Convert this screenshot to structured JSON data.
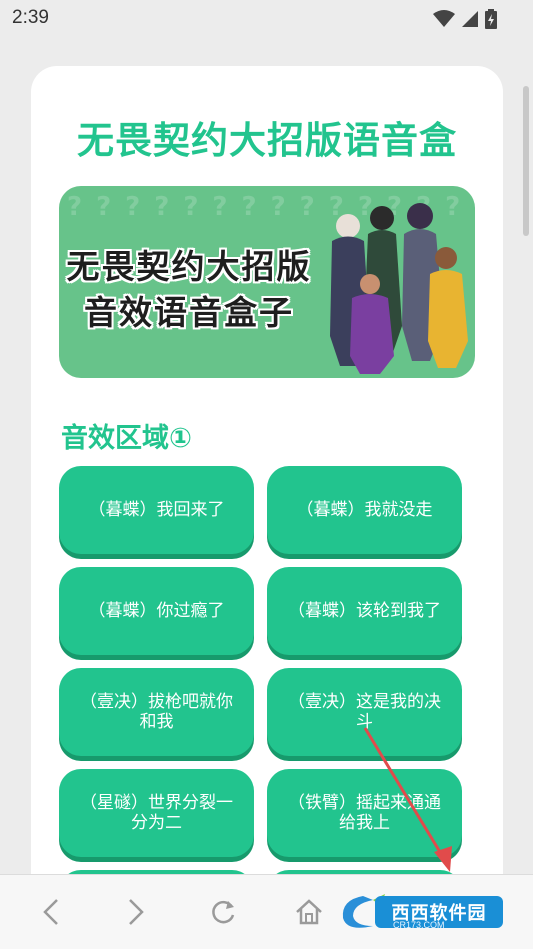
{
  "status_bar": {
    "time": "2:39"
  },
  "page": {
    "title": "无畏契约大招版语音盒",
    "banner": {
      "line1": "无畏契约大招版",
      "line2": "音效语音盒子"
    },
    "section_title": "音效区域①"
  },
  "sound_buttons": [
    {
      "label": "（暮蝶）我回来了"
    },
    {
      "label": "（暮蝶）我就没走"
    },
    {
      "label": "（暮蝶）你过瘾了"
    },
    {
      "label": "（暮蝶）该轮到我了"
    },
    {
      "label": "（壹决）拔枪吧就你和我"
    },
    {
      "label": "（壹决）这是我的决斗"
    },
    {
      "label": "（星礈）世界分裂一分为二"
    },
    {
      "label": "（铁臂）摇起来通通给我上"
    }
  ],
  "watermark": {
    "text": "西西软件园",
    "sub": "CR173.COM"
  },
  "colors": {
    "accent": "#22c48e",
    "accent_dark": "#179a6c",
    "banner_bg": "#67c38a"
  },
  "icons": {
    "status": [
      "wifi-icon",
      "signal-icon",
      "battery-icon"
    ],
    "nav": [
      "back-icon",
      "forward-icon",
      "refresh-icon",
      "home-icon"
    ]
  }
}
